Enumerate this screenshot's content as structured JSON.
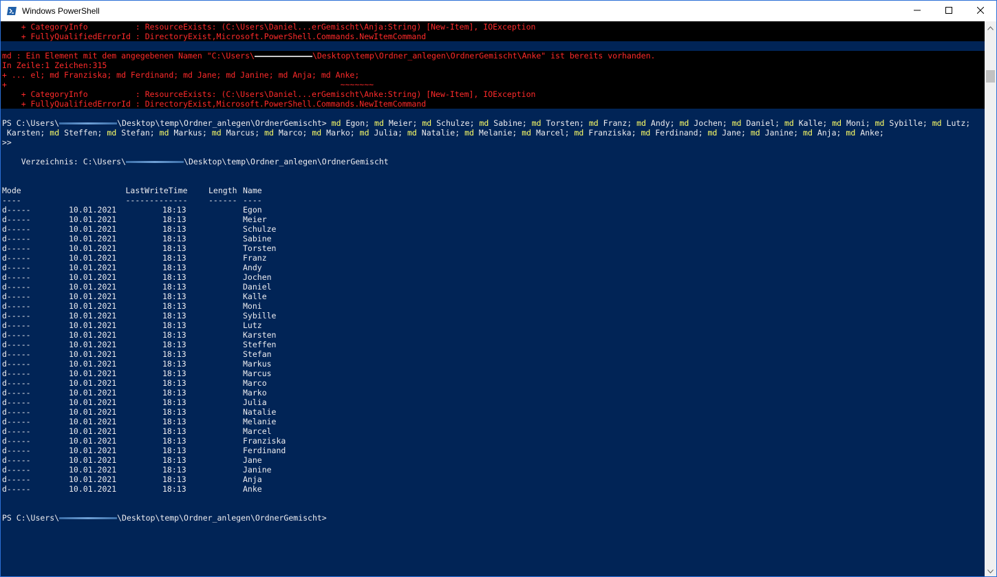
{
  "window": {
    "title": "Windows PowerShell",
    "colors": {
      "console_bg": "#012456",
      "error_bg": "#000000",
      "error_fg": "#ff2a2a",
      "command_fg": "#ffff66",
      "text_fg": "#eeedf0"
    }
  },
  "error1": {
    "category_line": "    + CategoryInfo          : ResourceExists: (C:\\Users\\Daniel...erGemischt\\Anja:String) [New-Item], IOException",
    "fqid_line": "    + FullyQualifiedErrorId : DirectoryExist,Microsoft.PowerShell.Commands.NewItemCommand"
  },
  "error2": {
    "message_prefix": "md : Ein Element mit dem angegebenen Namen \"C:\\Users\\",
    "message_suffix": "\\Desktop\\temp\\Ordner_anlegen\\OrdnerGemischt\\Anke\" ist bereits vorhanden.",
    "position_line": "In Zeile:1 Zeichen:315",
    "context_line": "+ ... el; md Franziska; md Ferdinand; md Jane; md Janine; md Anja; md Anke;",
    "marker_line": "+                                                                      ~~~~~~~",
    "category_line": "    + CategoryInfo          : ResourceExists: (C:\\Users\\Daniel...erGemischt\\Anke:String) [New-Item], IOException",
    "fqid_line": "    + FullyQualifiedErrorId : DirectoryExist,Microsoft.PowerShell.Commands.NewItemCommand"
  },
  "prompt": {
    "prefix": "PS C:\\Users\\",
    "suffix": "\\Desktop\\temp\\Ordner_anlegen\\OrdnerGemischt> ",
    "keyword": "md",
    "names_line1": [
      "Egon",
      "Meier",
      "Schulze",
      "Sabine",
      "Torsten",
      "Franz",
      "Andy",
      "Jochen",
      "Daniel",
      "Kalle",
      "Moni",
      "Sybille",
      "Lutz"
    ],
    "names_line2": [
      "Karsten",
      "Steffen",
      "Stefan",
      "Markus",
      "Marcus",
      "Marco",
      "Marko",
      "Julia",
      "Natalie",
      "Melanie",
      "Marcel",
      "Franziska",
      "Ferdinand",
      "Jane",
      "Janine",
      "Anja",
      "Anke"
    ],
    "continuation": ">>"
  },
  "directory": {
    "label_prefix": "    Verzeichnis: C:\\Users\\",
    "label_suffix": "\\Desktop\\temp\\Ordner_anlegen\\OrdnerGemischt"
  },
  "listing": {
    "headers": {
      "mode": "Mode",
      "lastwritetime": "LastWriteTime",
      "length": "Length",
      "name": "Name"
    },
    "underlines": {
      "mode": "----",
      "lastwritetime": "-------------",
      "length": "------",
      "name": "----"
    },
    "rows": [
      {
        "mode": "d-----",
        "date": "10.01.2021",
        "time": "18:13",
        "name": "Egon"
      },
      {
        "mode": "d-----",
        "date": "10.01.2021",
        "time": "18:13",
        "name": "Meier"
      },
      {
        "mode": "d-----",
        "date": "10.01.2021",
        "time": "18:13",
        "name": "Schulze"
      },
      {
        "mode": "d-----",
        "date": "10.01.2021",
        "time": "18:13",
        "name": "Sabine"
      },
      {
        "mode": "d-----",
        "date": "10.01.2021",
        "time": "18:13",
        "name": "Torsten"
      },
      {
        "mode": "d-----",
        "date": "10.01.2021",
        "time": "18:13",
        "name": "Franz"
      },
      {
        "mode": "d-----",
        "date": "10.01.2021",
        "time": "18:13",
        "name": "Andy"
      },
      {
        "mode": "d-----",
        "date": "10.01.2021",
        "time": "18:13",
        "name": "Jochen"
      },
      {
        "mode": "d-----",
        "date": "10.01.2021",
        "time": "18:13",
        "name": "Daniel"
      },
      {
        "mode": "d-----",
        "date": "10.01.2021",
        "time": "18:13",
        "name": "Kalle"
      },
      {
        "mode": "d-----",
        "date": "10.01.2021",
        "time": "18:13",
        "name": "Moni"
      },
      {
        "mode": "d-----",
        "date": "10.01.2021",
        "time": "18:13",
        "name": "Sybille"
      },
      {
        "mode": "d-----",
        "date": "10.01.2021",
        "time": "18:13",
        "name": "Lutz"
      },
      {
        "mode": "d-----",
        "date": "10.01.2021",
        "time": "18:13",
        "name": "Karsten"
      },
      {
        "mode": "d-----",
        "date": "10.01.2021",
        "time": "18:13",
        "name": "Steffen"
      },
      {
        "mode": "d-----",
        "date": "10.01.2021",
        "time": "18:13",
        "name": "Stefan"
      },
      {
        "mode": "d-----",
        "date": "10.01.2021",
        "time": "18:13",
        "name": "Markus"
      },
      {
        "mode": "d-----",
        "date": "10.01.2021",
        "time": "18:13",
        "name": "Marcus"
      },
      {
        "mode": "d-----",
        "date": "10.01.2021",
        "time": "18:13",
        "name": "Marco"
      },
      {
        "mode": "d-----",
        "date": "10.01.2021",
        "time": "18:13",
        "name": "Marko"
      },
      {
        "mode": "d-----",
        "date": "10.01.2021",
        "time": "18:13",
        "name": "Julia"
      },
      {
        "mode": "d-----",
        "date": "10.01.2021",
        "time": "18:13",
        "name": "Natalie"
      },
      {
        "mode": "d-----",
        "date": "10.01.2021",
        "time": "18:13",
        "name": "Melanie"
      },
      {
        "mode": "d-----",
        "date": "10.01.2021",
        "time": "18:13",
        "name": "Marcel"
      },
      {
        "mode": "d-----",
        "date": "10.01.2021",
        "time": "18:13",
        "name": "Franziska"
      },
      {
        "mode": "d-----",
        "date": "10.01.2021",
        "time": "18:13",
        "name": "Ferdinand"
      },
      {
        "mode": "d-----",
        "date": "10.01.2021",
        "time": "18:13",
        "name": "Jane"
      },
      {
        "mode": "d-----",
        "date": "10.01.2021",
        "time": "18:13",
        "name": "Janine"
      },
      {
        "mode": "d-----",
        "date": "10.01.2021",
        "time": "18:13",
        "name": "Anja"
      },
      {
        "mode": "d-----",
        "date": "10.01.2021",
        "time": "18:13",
        "name": "Anke"
      }
    ]
  },
  "final_prompt": {
    "prefix": "PS C:\\Users\\",
    "suffix": "\\Desktop\\temp\\Ordner_anlegen\\OrdnerGemischt>"
  },
  "icons": {
    "app": "powershell-icon",
    "minimize": "minimize-icon",
    "maximize": "maximize-icon",
    "close": "close-icon",
    "scroll_up": "arrow-up-icon",
    "scroll_down": "arrow-down-icon"
  }
}
